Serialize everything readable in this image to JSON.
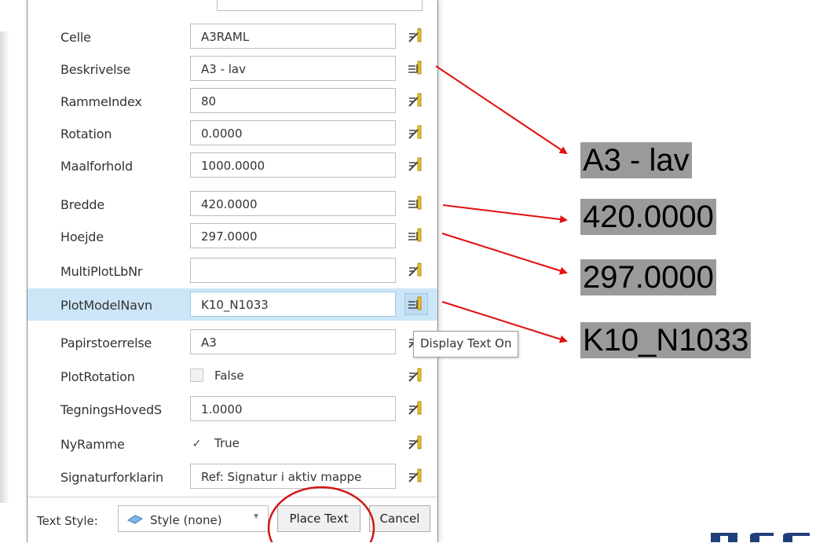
{
  "rows": [
    {
      "label": "Celle",
      "value": "A3RAML",
      "icon": "display-off-icon"
    },
    {
      "label": "Beskrivelse",
      "value": "A3 - lav",
      "icon": "display-on-icon"
    },
    {
      "label": "RammeIndex",
      "value": "80",
      "icon": "display-off-icon"
    },
    {
      "label": "Rotation",
      "value": "0.0000",
      "icon": "display-off-icon"
    },
    {
      "label": "Maalforhold",
      "value": "1000.0000",
      "icon": "display-off-icon"
    },
    {
      "label": "Bredde",
      "value": "420.0000",
      "icon": "display-on-icon"
    },
    {
      "label": "Hoejde",
      "value": "297.0000",
      "icon": "display-on-icon"
    },
    {
      "label": "MultiPlotLbNr",
      "value": "",
      "icon": "display-off-icon"
    },
    {
      "label": "PlotModelNavn",
      "value": "K10_N1033",
      "icon": "display-on-icon"
    },
    {
      "label": "Papirstoerrelse",
      "value": "A3",
      "icon": "display-off-icon"
    },
    {
      "label": "PlotRotation",
      "value": "False",
      "checked": false,
      "icon": "display-off-icon"
    },
    {
      "label": "TegningsHovedS",
      "value": "1.0000",
      "icon": "display-off-icon"
    },
    {
      "label": "NyRamme",
      "value": "True",
      "checked": true,
      "icon": "display-off-icon"
    },
    {
      "label": "Signaturforklarin",
      "value": "Ref: Signatur i aktiv mappe",
      "icon": "display-off-icon"
    }
  ],
  "tooltip": "Display Text On",
  "footer": {
    "text_style_label": "Text Style:",
    "text_style_value": "Style (none)",
    "place_text": "Place Text",
    "cancel": "Cancel"
  },
  "previews": [
    "A3 - lav",
    "420.0000",
    "297.0000",
    "K10_N1033"
  ],
  "colors": {
    "highlight": "#cce6f7",
    "arrow": "#e01010",
    "preview_bg": "#9a9a9a",
    "logo": "#1f3f7a"
  }
}
